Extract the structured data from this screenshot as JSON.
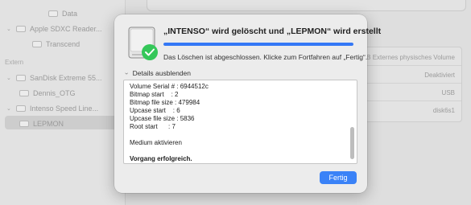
{
  "sidebar": {
    "items_top": [
      {
        "label": "Data",
        "indent": 2
      },
      {
        "label": "Apple SDXC Reader...",
        "indent": 1
      },
      {
        "label": "Transcend",
        "indent": 2
      }
    ],
    "section_label": "Extern",
    "items_extern": [
      {
        "label": "SanDisk Extreme 55...",
        "indent": 1
      },
      {
        "label": "Dennis_OTG",
        "indent": 2
      },
      {
        "label": "Intenso Speed Line...",
        "indent": 1
      },
      {
        "label": "LEPMON",
        "indent": 2
      }
    ]
  },
  "info_panel": {
    "rows": [
      "B Externes physisches Volume",
      "Deaktiviert",
      "USB",
      "disk6s1"
    ]
  },
  "dialog": {
    "title": "„INTENSO“ wird gelöscht und „LEPMON“ wird erstellt",
    "message": "Das Löschen ist abgeschlossen. Klicke zum Fortfahren auf „Fertig“.",
    "progress": 1.0,
    "details_label": "Details ausblenden",
    "log": [
      "Volume Serial # : 6944512c",
      "Bitmap start    : 2",
      "Bitmap file size : 479984",
      "Upcase start    : 6",
      "Upcase file size : 5836",
      "Root start      : 7",
      "",
      "Medium aktivieren",
      "",
      "Vorgang erfolgreich."
    ],
    "done_label": "Fertig",
    "colors": {
      "accent": "#3a82f7",
      "check": "#34c759"
    }
  }
}
